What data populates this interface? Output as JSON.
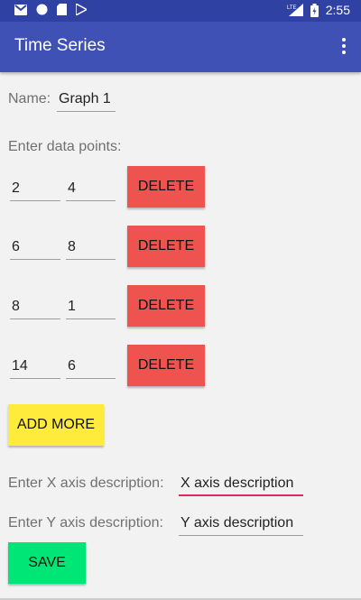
{
  "status": {
    "time": "2:55",
    "network": "LTE"
  },
  "app": {
    "title": "Time Series"
  },
  "form": {
    "name_label": "Name:",
    "name_value": "Graph 1",
    "points_label": "Enter data points:",
    "points": [
      {
        "x": "2",
        "y": "4"
      },
      {
        "x": "6",
        "y": "8"
      },
      {
        "x": "8",
        "y": "1"
      },
      {
        "x": "14",
        "y": "6"
      }
    ],
    "delete_label": "DELETE",
    "add_more_label": "ADD MORE",
    "x_axis_label": "Enter X axis description:",
    "x_axis_value": "X axis description",
    "y_axis_label": "Enter Y axis description:",
    "y_axis_value": "Y axis description",
    "save_label": "SAVE"
  },
  "colors": {
    "primary": "#3f51b5",
    "status_bar": "#2f42a4",
    "delete": "#ef5350",
    "add_more": "#ffeb3b",
    "save": "#00e676",
    "focus_underline": "#e5265f"
  }
}
